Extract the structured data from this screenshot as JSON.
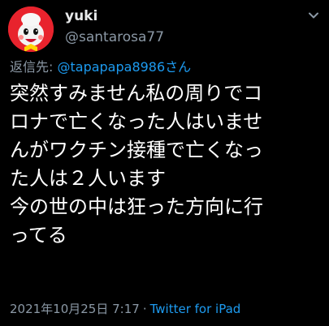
{
  "author": {
    "display_name": "yuki",
    "username": "@santarosa77",
    "avatar_icon": "red-mascot-avatar"
  },
  "more_icon": "chevron-down-icon",
  "reply": {
    "prefix": "返信先: ",
    "mention": "@tapapapa8986さん"
  },
  "tweet": {
    "lines": [
      "突然すみません私の周りでコ",
      "ロナで亡くなった人はいませ",
      "んがワクチン接種で亡くなっ",
      "た人は２人います",
      "今の世の中は狂った方向に行",
      "ってる"
    ]
  },
  "meta": {
    "timestamp": "2021年10月25日 7:17",
    "separator": "·",
    "client": "Twitter for iPad"
  },
  "colors": {
    "background": "#000000",
    "text": "#ffffff",
    "secondary": "#8b98a5",
    "link": "#1d9bf0",
    "avatar_red": "#e8232d"
  }
}
